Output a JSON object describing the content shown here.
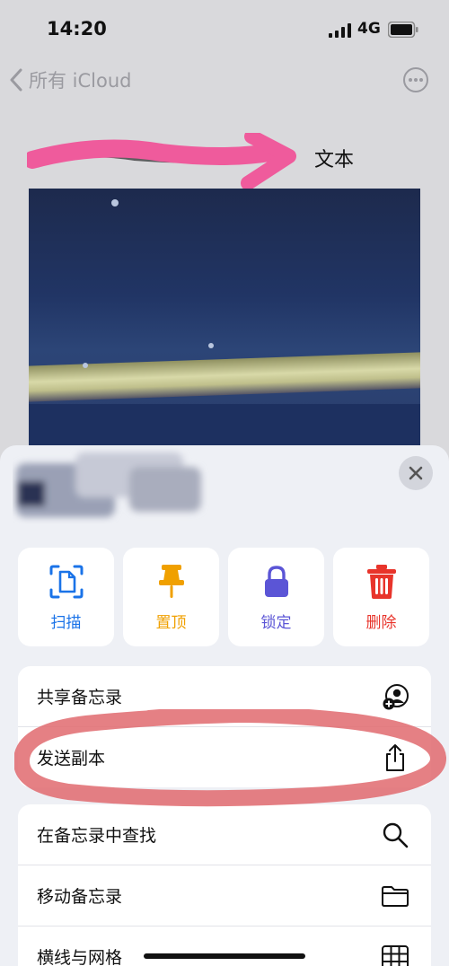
{
  "status_bar": {
    "time": "14:20",
    "network": "4G",
    "icons": [
      "signal-icon",
      "battery-icon"
    ]
  },
  "nav": {
    "back_label": "所有 iCloud",
    "back_icon": "chevron-left-icon",
    "more_icon": "ellipsis-circle-icon"
  },
  "note": {
    "visible_word": "文本"
  },
  "sheet": {
    "actions": [
      {
        "label": "扫描",
        "icon": "scan-document-icon",
        "color": "#1a73e8"
      },
      {
        "label": "置顶",
        "icon": "pin-icon",
        "color": "#f0a000"
      },
      {
        "label": "锁定",
        "icon": "lock-icon",
        "color": "#5b55d6"
      },
      {
        "label": "删除",
        "icon": "trash-icon",
        "color": "#e8342b"
      }
    ],
    "group1": [
      {
        "label": "共享备忘录",
        "icon": "share-person-icon"
      },
      {
        "label": "发送副本",
        "icon": "share-upload-icon"
      }
    ],
    "group2": [
      {
        "label": "在备忘录中查找",
        "icon": "search-icon"
      },
      {
        "label": "移动备忘录",
        "icon": "folder-icon"
      },
      {
        "label": "横线与网格",
        "icon": "grid-icon"
      }
    ]
  },
  "colors": {
    "scan": "#1a73e8",
    "pin": "#f0a000",
    "lock": "#5b55d6",
    "delete": "#e8342b",
    "highlight": "#e06a6f"
  }
}
